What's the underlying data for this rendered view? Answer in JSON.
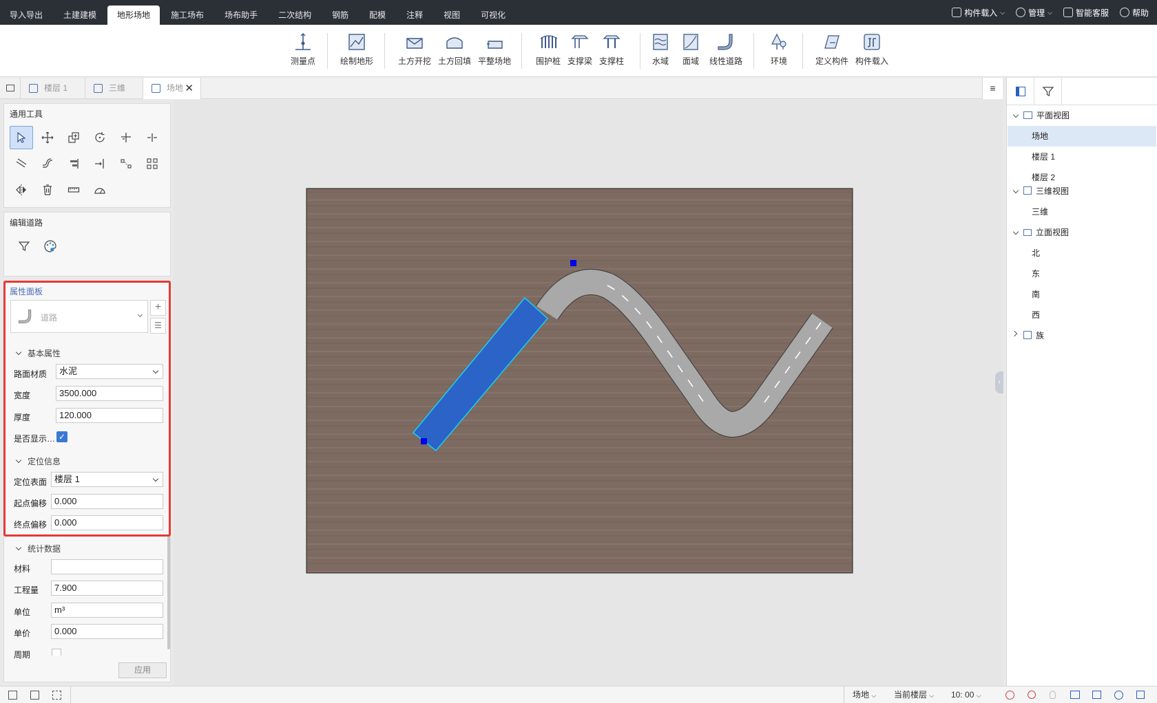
{
  "menu": {
    "tabs": [
      "导入导出",
      "土建建模",
      "地形场地",
      "施工场布",
      "场布助手",
      "二次结构",
      "钢筋",
      "配模",
      "注释",
      "视图",
      "可视化"
    ],
    "active_tab": "地形场地",
    "right": {
      "component_load": "构件载入",
      "manage": "管理",
      "service": "智能客服",
      "help": "帮助"
    }
  },
  "ribbon": {
    "tools": [
      "测量点",
      "绘制地形",
      "土方开挖",
      "土方回填",
      "平整场地",
      "围护桩",
      "支撑梁",
      "支撑柱",
      "水域",
      "面域",
      "线性道路",
      "环境",
      "定义构件",
      "构件载入"
    ]
  },
  "view_tabs": [
    "楼层 1",
    "三维",
    "场地"
  ],
  "active_view_tab": "场地",
  "left": {
    "common_tools_title": "通用工具",
    "edit_road_title": "编辑道路",
    "props_title": "属性面板",
    "type_selector": "道路",
    "basic_section": "基本属性",
    "road_material_label": "路面材质",
    "road_material_value": "水泥",
    "width_label": "宽度",
    "width_value": "3500.000",
    "thickness_label": "厚度",
    "thickness_value": "120.000",
    "show_label": "是否显示…",
    "show_checked": true,
    "position_section": "定位信息",
    "position_surface_label": "定位表面",
    "position_surface_value": "楼层 1",
    "start_offset_label": "起点偏移",
    "start_offset_value": "0.000",
    "end_offset_label": "终点偏移",
    "end_offset_value": "0.000",
    "stats_section": "统计数据",
    "material_label": "材料",
    "material_value": "",
    "quantity_label": "工程量",
    "quantity_value": "7.900",
    "unit_label": "单位",
    "unit_value": "m³",
    "price_label": "单价",
    "price_value": "0.000",
    "period_label": "周期",
    "apply_button": "应用"
  },
  "tree": {
    "plan_views": "平面视图",
    "plan_items": [
      "场地",
      "楼层 1",
      "楼层 2"
    ],
    "selected": "场地",
    "three_d_views": "三维视图",
    "three_d_items": [
      "三维"
    ],
    "elevation_views": "立面视图",
    "elevation_items": [
      "北",
      "东",
      "南",
      "西"
    ],
    "family": "族"
  },
  "status": {
    "site": "场地",
    "current_floor": "当前楼层",
    "scale": "10: 00"
  },
  "colors": {
    "accent": "#2b63c7",
    "highlight_red": "#e53935",
    "terrain": "#7d6a60",
    "road": "#a9a9a9",
    "selected_road": "#2b63c7",
    "selection_outline": "#19d0f0"
  }
}
